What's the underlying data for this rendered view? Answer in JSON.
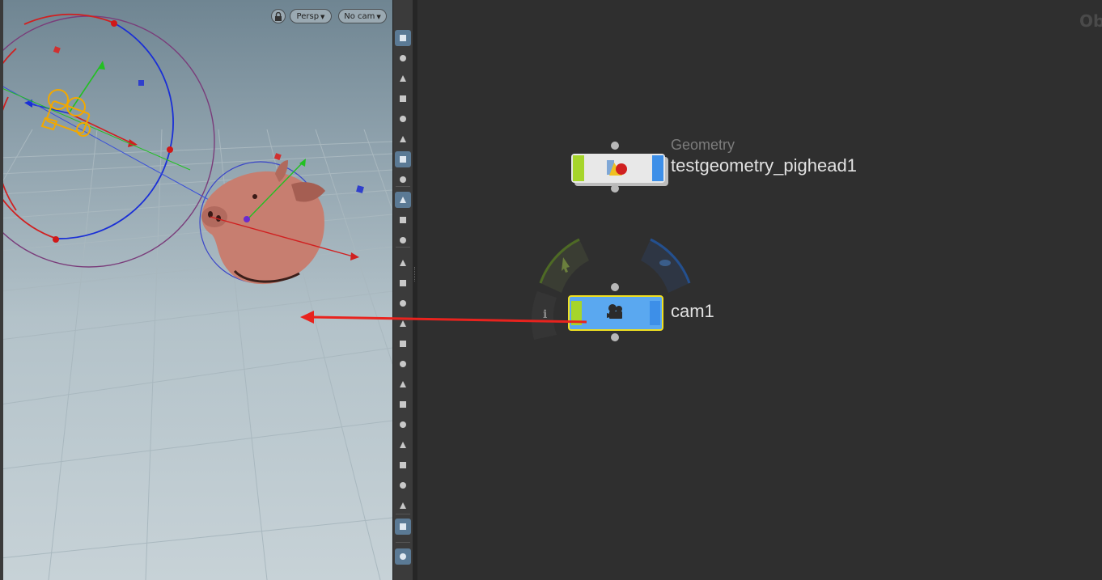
{
  "viewport": {
    "view_menu": "Persp",
    "camera_menu": "No cam",
    "lock_icon": "lock-icon"
  },
  "toolbar": {
    "buttons": [
      "display-options-icon",
      "visualizers-icon",
      "lock-view-icon",
      "ghost-icon",
      "shading-icon",
      "light-icon",
      "headlight-icon",
      "display-light-icon",
      "camera-view-icon",
      "eye-visibility-icon",
      "texture-icon",
      "point-icon",
      "point-normals-icon",
      "normals-icon",
      "point-numbers-icon",
      "prim-normals-icon",
      "prim-numbers-icon",
      "edge-icon",
      "backface-icon",
      "uv-icon",
      "layers-icon",
      "group-icon",
      "pivot-icon",
      "template-icon",
      "background-image-icon",
      "snap-icon"
    ]
  },
  "network": {
    "context_label": "Ob",
    "nodes": [
      {
        "type_label": "Geometry",
        "name": "testgeometry_pighead1"
      },
      {
        "type_label": "",
        "name": "cam1"
      }
    ],
    "colors": {
      "node_green": "#a6d52b",
      "node_blue": "#5aa8f0",
      "selected_outline": "#f0e020",
      "arrow": "#e8231e"
    }
  }
}
